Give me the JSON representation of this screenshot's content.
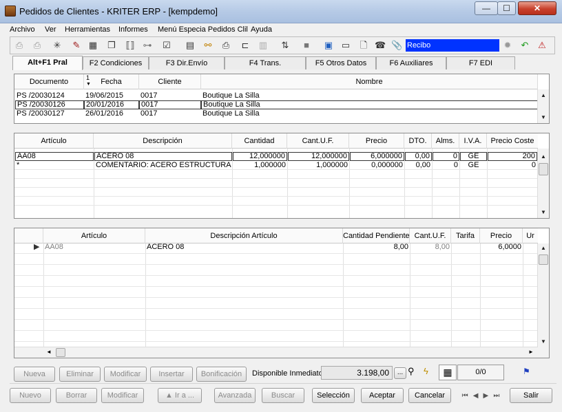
{
  "window": {
    "title": "Pedidos de Clientes - KRITER ERP - [kempdemo]",
    "minimize": "—",
    "maximize": "☐",
    "close": "✕"
  },
  "menu": [
    "Archivo",
    "Ver",
    "Herramientas",
    "Informes",
    "Menú Especia Pedidos Clil",
    "Ayuda"
  ],
  "toolbar": {
    "recibo": "Recibo"
  },
  "tabs": [
    "Alt+F1 Pral",
    "F2 Condiciones",
    "F3 Dir.Envío",
    "F4 Trans.",
    "F5 Otros Datos",
    "F6 Auxiliares",
    "F7 EDI"
  ],
  "orders": {
    "headers": [
      "Documento",
      "Fecha",
      "Cliente",
      "Nombre"
    ],
    "sort_mark": "1",
    "rows": [
      [
        "PS /20030124",
        "19/06/2015",
        "0017",
        "Boutique La Silla"
      ],
      [
        "PS /20030126",
        "20/01/2016",
        "0017",
        "Boutique La Silla"
      ],
      [
        "PS /20030127",
        "26/01/2016",
        "0017",
        "Boutique La Silla"
      ]
    ]
  },
  "lines": {
    "headers": [
      "Artículo",
      "Descripción",
      "Cantidad",
      "Cant.U.F.",
      "Precio",
      "DTO.",
      "Alms.",
      "I.V.A.",
      "Precio Coste"
    ],
    "rows": [
      [
        "AA08",
        "ACERO 08",
        "12,000000",
        "12,000000",
        "6,000000",
        "0,00",
        "0",
        "GE",
        "200"
      ],
      [
        "*",
        "COMENTARIO:  ACERO ESTRUCTURA",
        "1,000000",
        "1,000000",
        "0,000000",
        "0,00",
        "0",
        "GE",
        "0"
      ]
    ]
  },
  "pending": {
    "headers": [
      "Artículo",
      "Descripción Artículo",
      "Cantidad Pendiente",
      "Cant.U.F.",
      "Tarifa",
      "Precio",
      "Ur"
    ],
    "rows": [
      [
        "AA08",
        "ACERO 08",
        "8,00",
        "8,00",
        "",
        "6,0000",
        ""
      ]
    ]
  },
  "lower_actions": {
    "nueva": "Nueva",
    "eliminar": "Eliminar",
    "modificar": "Modificar",
    "insertar": "Insertar",
    "bonificacion": "Bonificación",
    "disponible_label": "Disponible Inmediato",
    "disponible_value": "3.198,00",
    "dots": "...",
    "counter": "0/0"
  },
  "bottom_actions": {
    "nuevo": "Nuevo",
    "borrar": "Borrar",
    "modificar": "Modificar",
    "ir_a": "▲ Ir a ...",
    "avanzada": "Avanzada",
    "buscar": "Buscar",
    "seleccion": "Selección",
    "aceptar": "Aceptar",
    "cancelar": "Cancelar",
    "salir": "Salir"
  }
}
